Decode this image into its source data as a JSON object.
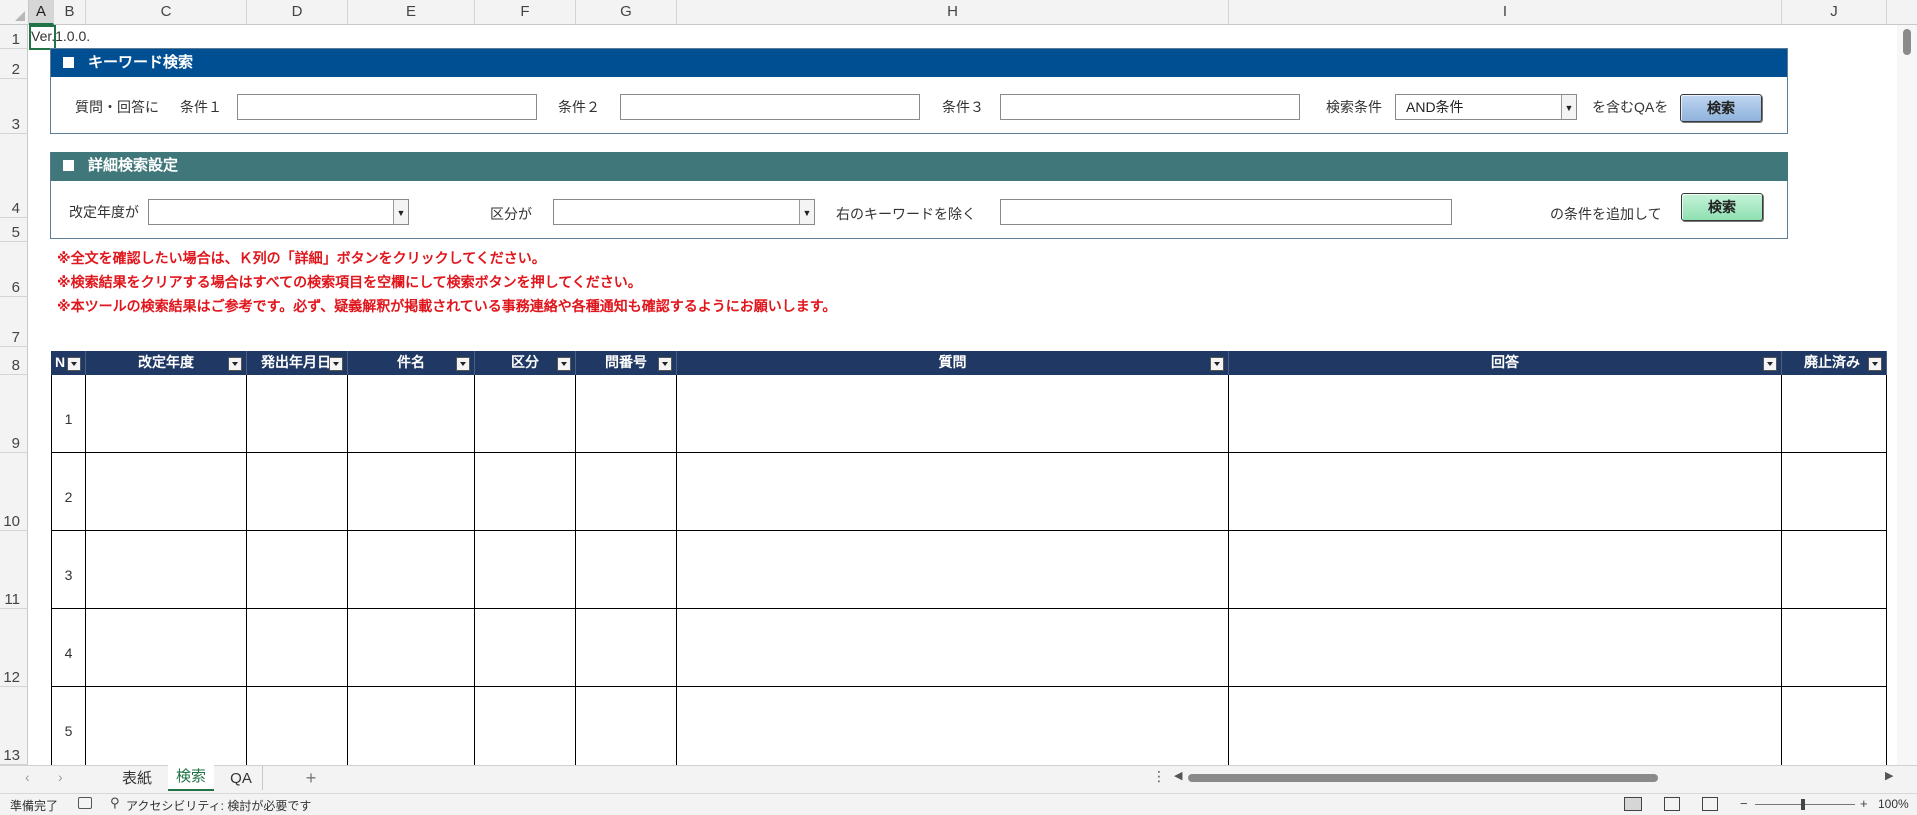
{
  "columns": [
    "A",
    "B",
    "C",
    "D",
    "E",
    "F",
    "G",
    "H",
    "I",
    "J"
  ],
  "selected_column": "A",
  "rows": [
    "1",
    "2",
    "3",
    "4",
    "5",
    "6",
    "7",
    "8",
    "9",
    "10",
    "11",
    "12",
    "13"
  ],
  "cell_a1": "Ver.1.0.0.",
  "keyword_panel": {
    "title": "キーワード検索",
    "prefix_label": "質問・回答に",
    "cond1_label": "条件１",
    "cond2_label": "条件２",
    "cond3_label": "条件３",
    "search_cond_label": "検索条件",
    "search_cond_value": "AND条件",
    "suffix_label": "を含むQAを",
    "button": "検索",
    "header_color": "#004f93"
  },
  "detail_panel": {
    "title": "詳細検索設定",
    "year_label": "改定年度が",
    "year_value": "",
    "category_label": "区分が",
    "category_value": "",
    "exclude_label": "右のキーワードを除く",
    "suffix_label": "の条件を追加して",
    "button": "検索",
    "header_color": "#40777a"
  },
  "notes": [
    "※全文を確認したい場合は、Ｋ列の「詳細」ボタンをクリックしてください。",
    "※検索結果をクリアする場合はすべての検索項目を空欄にして検索ボタンを押してください。",
    "※本ツールの検索結果はご参考です。必ず、疑義解釈が掲載されている事務連絡や各種通知も確認するようにお願いします。"
  ],
  "table": {
    "headers": [
      "N",
      "改定年度",
      "発出年月日",
      "件名",
      "区分",
      "問番号",
      "質問",
      "回答",
      "廃止済み"
    ],
    "row_numbers": [
      "1",
      "2",
      "3",
      "4",
      "5"
    ]
  },
  "sheet_tabs": [
    "表紙",
    "検索",
    "QA"
  ],
  "active_tab": "検索",
  "add_sheet": "+",
  "status": {
    "ready": "準備完了",
    "accessibility": "アクセシビリティ: 検討が必要です",
    "zoom": "100%"
  }
}
